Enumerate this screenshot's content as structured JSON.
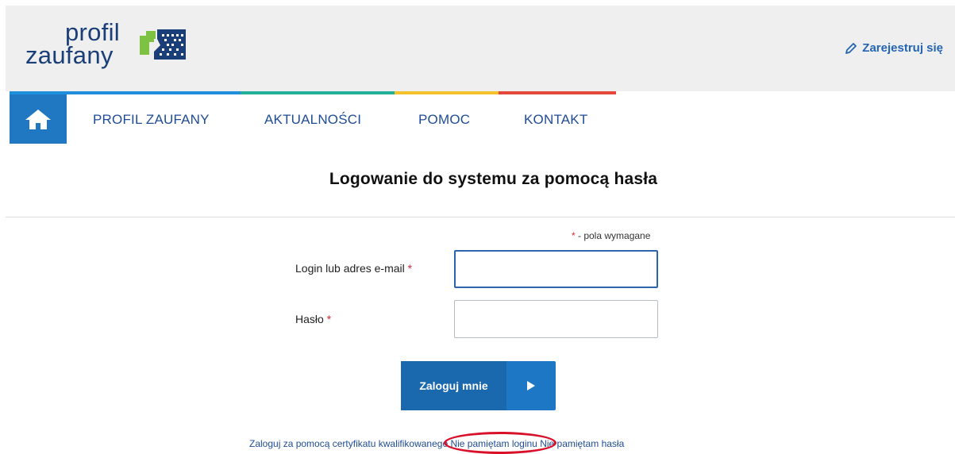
{
  "header": {
    "logo_line1": "profil",
    "logo_line2": "zaufany",
    "register_label": "Zarejestruj się"
  },
  "nav": {
    "items": [
      {
        "label": "PROFIL ZAUFANY"
      },
      {
        "label": "AKTUALNOŚCI"
      },
      {
        "label": "POMOC"
      },
      {
        "label": "KONTAKT"
      }
    ],
    "colors": [
      "#1f8fdb",
      "#22b09b",
      "#f4c22a",
      "#e5483a"
    ]
  },
  "main": {
    "title": "Logowanie do systemu za pomocą hasła",
    "required_star": "*",
    "required_note": " - pola wymagane",
    "login_label": "Login lub adres e-mail",
    "login_value": "",
    "password_label": "Hasło",
    "password_value": "",
    "submit_label": "Zaloguj mnie"
  },
  "links": {
    "certificate": "Zaloguj za pomocą certyfikatu kwalifikowanego",
    "forgot_login": "Nie pamiętam loginu",
    "forgot_password": "Nie pamiętam hasła"
  },
  "colors": {
    "brand_blue": "#1f78c1",
    "link_blue": "#1f4c95",
    "highlight_red": "#d8102a"
  }
}
